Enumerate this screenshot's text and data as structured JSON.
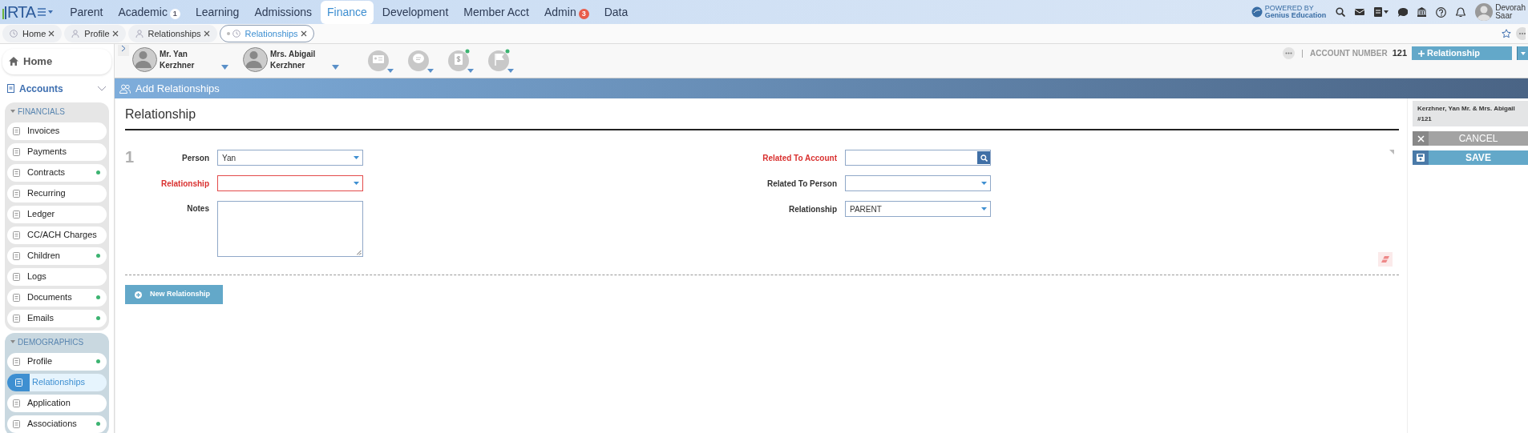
{
  "top_nav": {
    "logo": "RTA",
    "items": [
      {
        "label": "Parent",
        "selected": false
      },
      {
        "label": "Academic",
        "selected": false,
        "badge": {
          "text": "1",
          "color": "#ffffff"
        }
      },
      {
        "label": "Learning",
        "selected": false
      },
      {
        "label": "Admissions",
        "selected": false
      },
      {
        "label": "Finance",
        "selected": true
      },
      {
        "label": "Development",
        "selected": false
      },
      {
        "label": "Member Acct",
        "selected": false
      },
      {
        "label": "Admin",
        "selected": false,
        "badge": {
          "text": "3",
          "color": "#e85c4a"
        }
      },
      {
        "label": "Data",
        "selected": false
      }
    ],
    "powered_by": [
      "POWERED BY",
      "Genius Education"
    ],
    "user": [
      "Devorah",
      "Saar"
    ]
  },
  "open_tabs": [
    {
      "label": "Home",
      "selected": false
    },
    {
      "label": "Profile",
      "selected": false
    },
    {
      "label": "Relationships",
      "selected": false
    },
    {
      "label": "Relationships",
      "selected": true
    }
  ],
  "sidebar": {
    "home": "Home",
    "accounts": "Accounts",
    "sections": [
      {
        "title": "FINANCIALS",
        "items": [
          {
            "label": "Invoices",
            "dot": false,
            "selected": false
          },
          {
            "label": "Payments",
            "dot": false,
            "selected": false
          },
          {
            "label": "Contracts",
            "dot": true,
            "selected": false
          },
          {
            "label": "Recurring",
            "dot": false,
            "selected": false
          },
          {
            "label": "Ledger",
            "dot": false,
            "selected": false
          },
          {
            "label": "CC/ACH Charges",
            "dot": false,
            "selected": false
          },
          {
            "label": "Children",
            "dot": true,
            "selected": false
          },
          {
            "label": "Logs",
            "dot": false,
            "selected": false
          },
          {
            "label": "Documents",
            "dot": true,
            "selected": false
          },
          {
            "label": "Emails",
            "dot": true,
            "selected": false
          }
        ]
      },
      {
        "title": "DEMOGRAPHICS",
        "items": [
          {
            "label": "Profile",
            "dot": true,
            "selected": false
          },
          {
            "label": "Relationships",
            "dot": false,
            "selected": true
          },
          {
            "label": "Application",
            "dot": false,
            "selected": false
          },
          {
            "label": "Associations",
            "dot": true,
            "selected": false
          }
        ]
      }
    ]
  },
  "contacts": [
    {
      "name": [
        "Mr. Yan",
        "Kerzhner"
      ]
    },
    {
      "name": [
        "Mrs. Abigail",
        "Kerzhner"
      ]
    }
  ],
  "quick_actions": [
    {
      "kind": "card",
      "dot": false
    },
    {
      "kind": "chat",
      "dot": false
    },
    {
      "kind": "document",
      "dot": true
    },
    {
      "kind": "flag",
      "dot": true
    }
  ],
  "account": {
    "label": "ACCOUNT NUMBER",
    "number": "121",
    "add_button": "Relationship"
  },
  "page_title": "Add Relationships",
  "form": {
    "title": "Relationship",
    "index": "1",
    "left_fields": [
      {
        "label": "Person",
        "kind": "select",
        "value": "Yan",
        "required": false,
        "error": false
      },
      {
        "label": "Relationship",
        "kind": "select",
        "required": true,
        "error": true
      },
      {
        "label": "Notes",
        "kind": "textarea",
        "required": false,
        "error": false
      }
    ],
    "right_fields": [
      {
        "label": "Related To Account",
        "kind": "search",
        "required": true,
        "error": false
      },
      {
        "label": "Related To Person",
        "kind": "select",
        "required": false,
        "error": false
      },
      {
        "label": "Relationship",
        "kind": "select",
        "value": "PARENT",
        "required": false,
        "error": false
      }
    ],
    "new_button": "New Relationship"
  },
  "side_panel": {
    "account_name": [
      "Kerzhner, Yan Mr. & Mrs. Abigail",
      "#121"
    ],
    "cancel": "CANCEL",
    "save": "SAVE"
  }
}
